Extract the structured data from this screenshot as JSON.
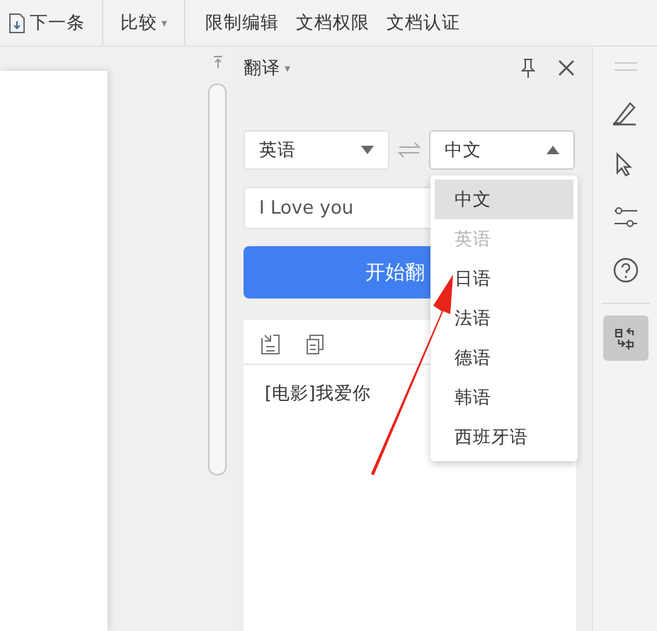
{
  "toolbar": {
    "items": [
      {
        "kind": "icon-button",
        "label": "下一条"
      },
      {
        "kind": "menu",
        "label": "比较",
        "caret": "▾"
      },
      {
        "kind": "plain",
        "label": "限制编辑"
      },
      {
        "kind": "plain",
        "label": "文档权限"
      },
      {
        "kind": "plain",
        "label": "文档认证"
      }
    ]
  },
  "panel": {
    "title": "翻译",
    "title_caret": "▾",
    "source_language": {
      "value": "英语",
      "expanded": false
    },
    "target_language": {
      "value": "中文",
      "expanded": true
    },
    "input": {
      "value": "I Love you"
    },
    "translate_button": "开始翻",
    "result": {
      "text": "[电影]我爱你"
    },
    "language_menu": [
      {
        "label": "中文",
        "selected": true,
        "disabled": false
      },
      {
        "label": "英语",
        "selected": false,
        "disabled": true
      },
      {
        "label": "日语",
        "selected": false,
        "disabled": false
      },
      {
        "label": "法语",
        "selected": false,
        "disabled": false
      },
      {
        "label": "德语",
        "selected": false,
        "disabled": false
      },
      {
        "label": "韩语",
        "selected": false,
        "disabled": false
      },
      {
        "label": "西班牙语",
        "selected": false,
        "disabled": false
      }
    ]
  },
  "side_tools": [
    {
      "kind": "pen",
      "active": false
    },
    {
      "kind": "cursor",
      "active": false
    },
    {
      "kind": "sliders",
      "active": false
    },
    {
      "kind": "help",
      "active": false
    },
    {
      "kind": "translate",
      "active": true
    }
  ]
}
